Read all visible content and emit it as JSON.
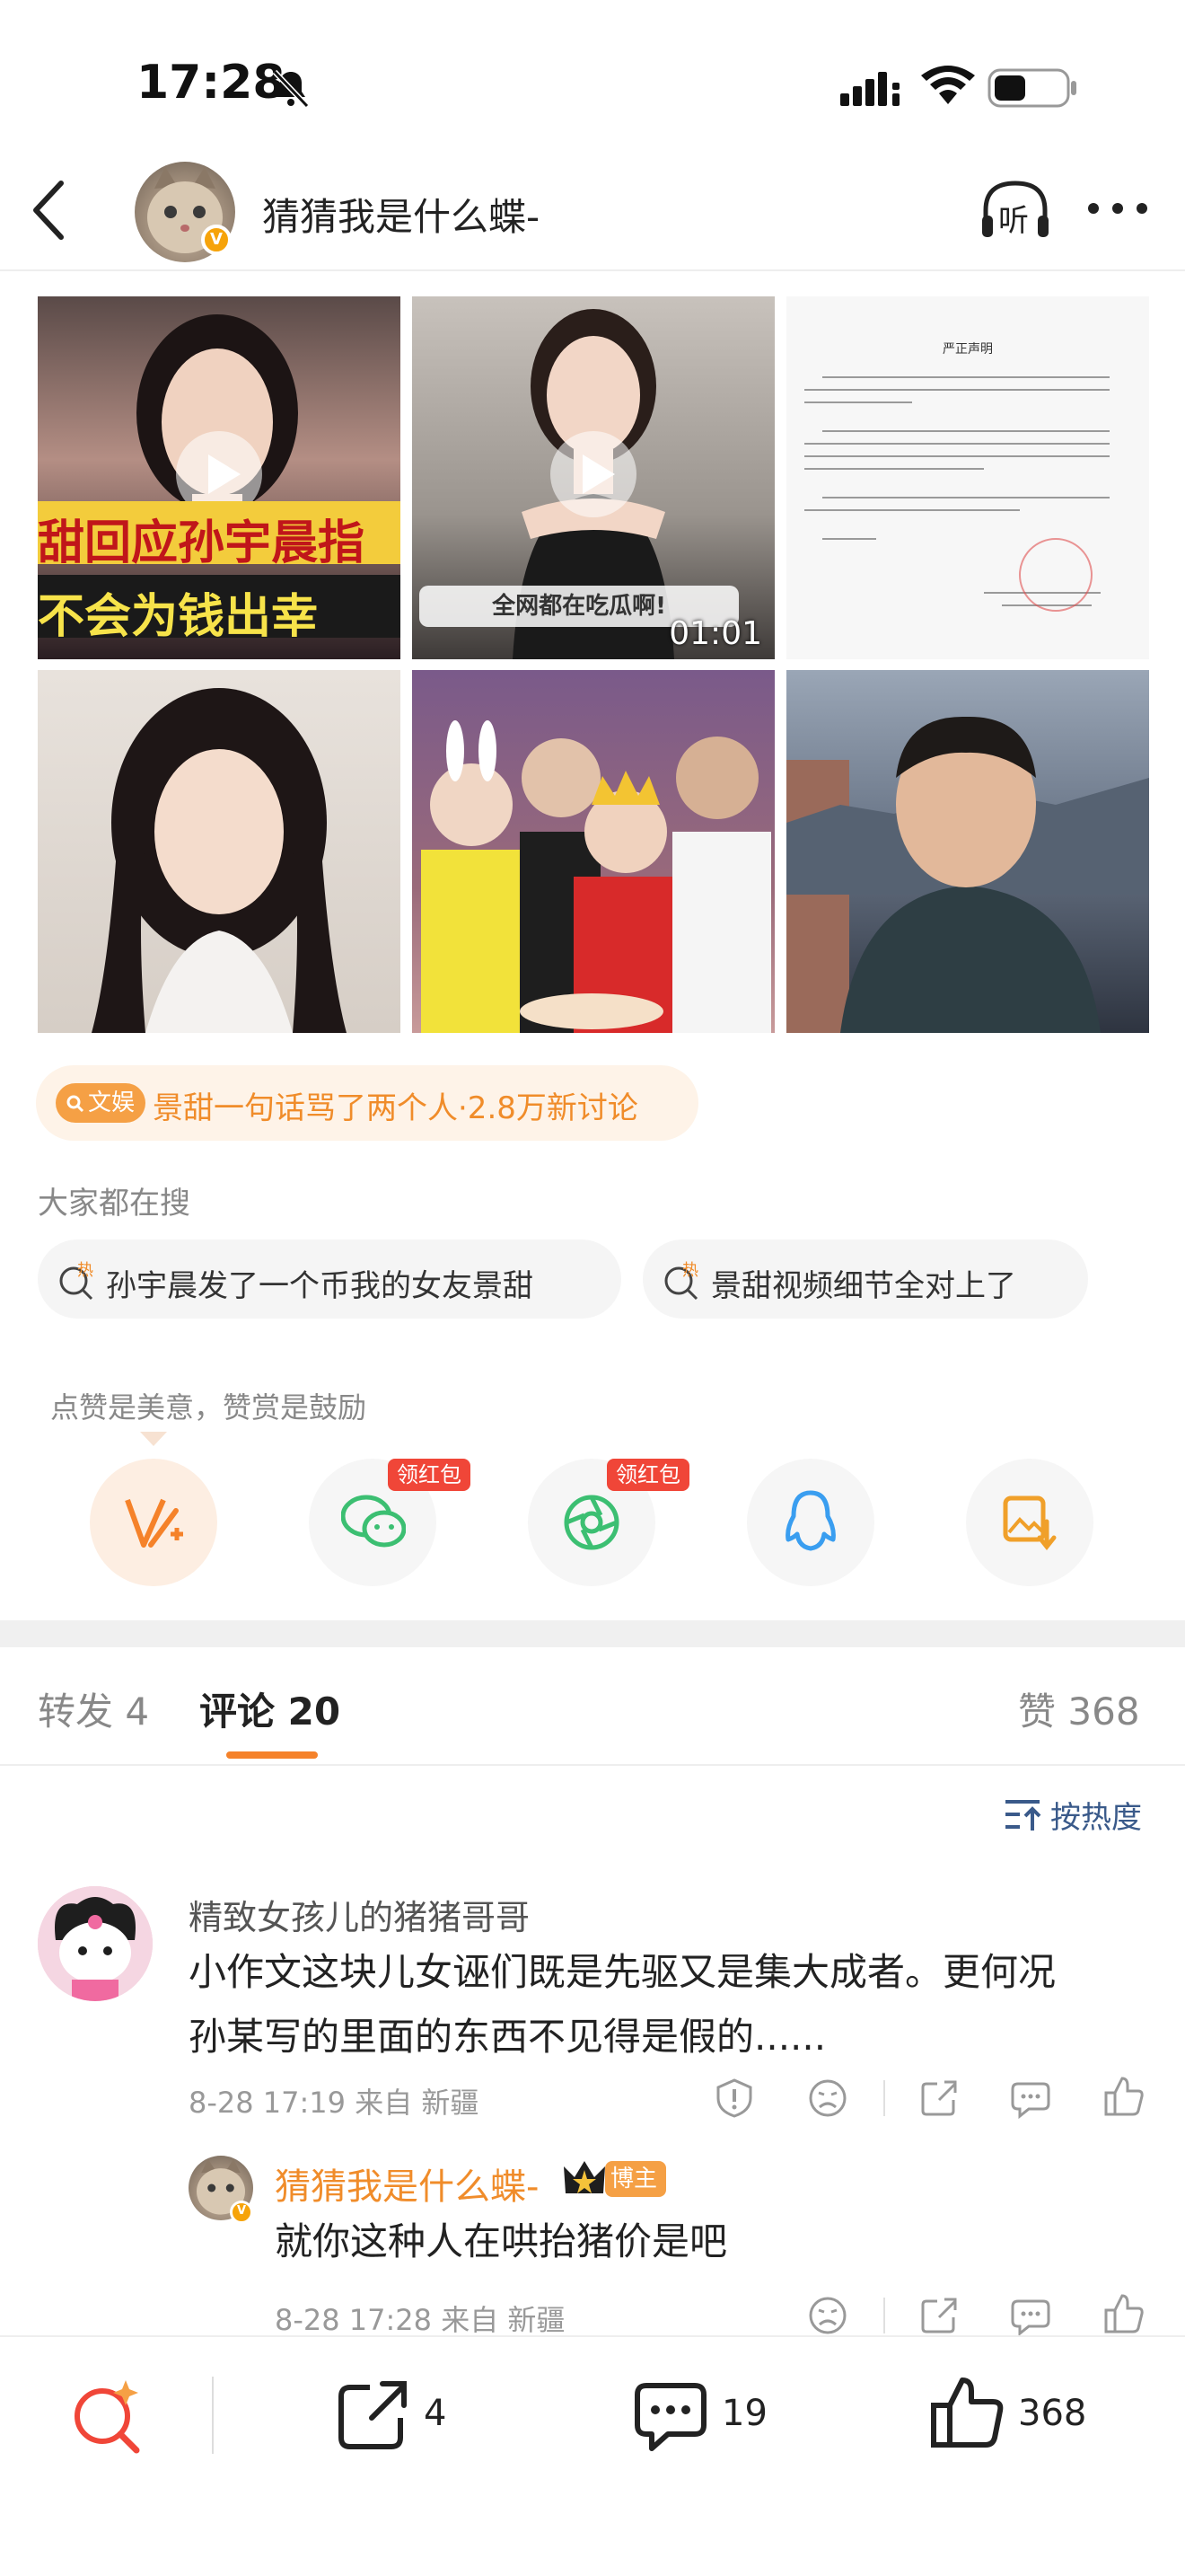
{
  "status_bar": {
    "time": "17:28"
  },
  "header": {
    "username": "猜猜我是什么蝶-",
    "listen_label": "听"
  },
  "media": {
    "image1_caption_top": "甜回应孙宇晨指",
    "image1_caption_bottom": "不会为钱出幸",
    "image2_subtitle": "全网都在吃瓜啊!",
    "image2_duration": "01:01",
    "image3_title": "严正声明"
  },
  "topic": {
    "tag": "文娱",
    "text": "景甜一句话骂了两个人·2.8万新讨论"
  },
  "search": {
    "label": "大家都在搜",
    "items": [
      {
        "text": "孙宇晨发了一个币我的女友景甜",
        "badge": "热"
      },
      {
        "text": "景甜视频细节全对上了",
        "badge": "热"
      }
    ]
  },
  "reward": {
    "hint": "点赞是美意，赞赏是鼓励",
    "hongbao_label": "领红包"
  },
  "tabs": {
    "repost_label": "转发",
    "repost_count": "4",
    "comment_label": "评论",
    "comment_count": "20",
    "like_label": "赞",
    "like_count": "368"
  },
  "sort": {
    "label": "按热度"
  },
  "comments": [
    {
      "user": "精致女孩儿的猪猪哥哥",
      "line1": "小作文这块儿女诬们既是先驱又是集大成者。更何况",
      "line2": "孙某写的里面的东西不见得是假的......",
      "time": "8-28 17:19",
      "from_label": "来自",
      "location": "新疆",
      "reply": {
        "user": "猜猜我是什么蝶-",
        "badge": "博主",
        "text": "就你这种人在哄抬猪价是吧",
        "time": "8-28 17:28",
        "from_label": "来自",
        "location": "新疆"
      }
    }
  ],
  "bottom_bar": {
    "repost_count": "4",
    "comment_count": "19",
    "like_count": "368"
  },
  "colors": {
    "accent": "#f5822a",
    "link": "#3a5a8a",
    "hot_tag": "#f5a045",
    "hongbao": "#f04638"
  }
}
